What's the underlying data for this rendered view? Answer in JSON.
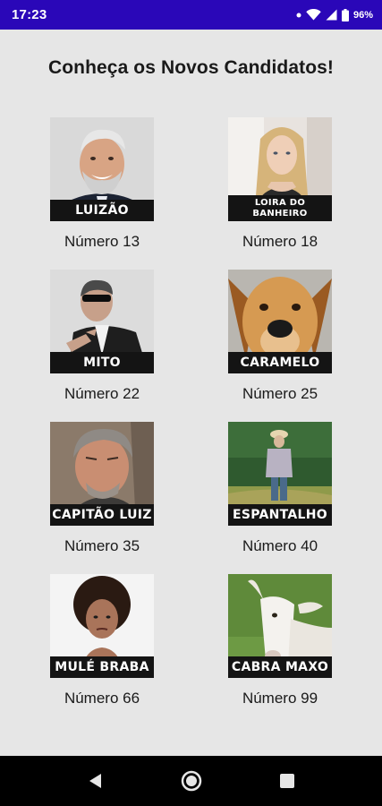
{
  "status_bar": {
    "time": "17:23",
    "battery_text": "96%",
    "icons": [
      "notification-dot-icon",
      "wifi-icon",
      "cellular-signal-icon",
      "battery-icon"
    ]
  },
  "page": {
    "title": "Conheça os Novos Candidatos!"
  },
  "candidates": [
    {
      "name": "LUIZÃO",
      "number": "Número 13",
      "photo": "smiling-man-photo"
    },
    {
      "name": "LOIRA DO BANHEIRO",
      "number": "Número 18",
      "photo": "blonde-woman-photo"
    },
    {
      "name": "MITO",
      "number": "Número 22",
      "photo": "man-in-suit-sunglasses-photo"
    },
    {
      "name": "CARAMELO",
      "number": "Número 25",
      "photo": "caramel-dog-photo"
    },
    {
      "name": "CAPITÃO LUIZ",
      "number": "Número 35",
      "photo": "grey-haired-man-photo"
    },
    {
      "name": "ESPANTALHO",
      "number": "Número 40",
      "photo": "scarecrow-field-photo"
    },
    {
      "name": "MULÉ BRABA",
      "number": "Número 66",
      "photo": "curly-haired-woman-photo"
    },
    {
      "name": "CABRA MAXO",
      "number": "Número 99",
      "photo": "white-goat-photo"
    }
  ],
  "nav_bar": {
    "buttons": [
      "back-icon",
      "home-icon",
      "recents-icon"
    ]
  }
}
